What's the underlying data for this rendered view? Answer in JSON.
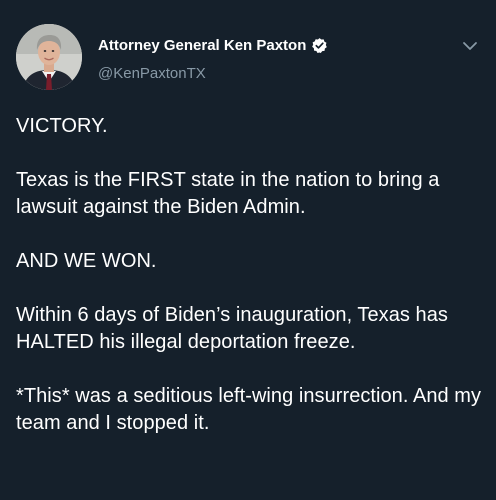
{
  "author": {
    "display_name": "Attorney General Ken Paxton",
    "handle": "@KenPaxtonTX",
    "avatar_icon": "profile-photo",
    "verified_icon": "verified-badge-icon",
    "menu_icon": "chevron-down-icon"
  },
  "tweet": {
    "paragraphs": [
      "VICTORY.",
      "Texas is the FIRST state in the nation to bring a lawsuit against the Biden Admin.",
      "AND WE WON.",
      "Within 6 days of Biden’s inauguration, Texas has HALTED his illegal deportation freeze.",
      "*This* was a seditious left-wing insurrection. And my team and I stopped it."
    ]
  },
  "colors": {
    "background": "#15202b",
    "text": "#ffffff",
    "secondary_text": "#8899a6"
  }
}
